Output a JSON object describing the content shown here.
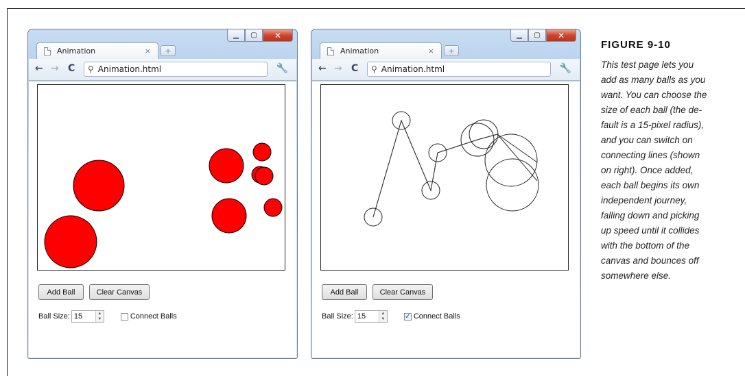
{
  "figure": {
    "title": "FIGURE 9-10",
    "caption_lines": [
      "This test page lets you",
      "add as many balls as you",
      "want. You can choose the",
      "size of each ball (the de-",
      "fault is a 15-pixel radius),",
      "and you can switch on",
      "connecting lines (shown",
      "on right). Once added,",
      "each ball begins its own",
      "independent journey,",
      "falling down and picking",
      "up speed until it collides",
      "with the bottom of the",
      "canvas and bounces off",
      "somewhere else."
    ]
  },
  "left_window": {
    "tab_title": "Animation",
    "tab_close": "×",
    "new_tab_icon": "+",
    "address": "Animation.html",
    "add_button": "Add Ball",
    "clear_button": "Clear Canvas",
    "ball_size_label": "Ball Size:",
    "ball_size_value": "15",
    "connect_label": "Connect Balls",
    "connect_checked": false,
    "ball_color": "#ff0000"
  },
  "right_window": {
    "tab_title": "Animation",
    "tab_close": "×",
    "new_tab_icon": "+",
    "address": "Animation.html",
    "add_button": "Add Ball",
    "clear_button": "Clear Canvas",
    "ball_size_label": "Ball Size:",
    "ball_size_value": "15",
    "connect_label": "Connect Balls",
    "connect_checked": true,
    "ball_color": "none"
  },
  "icons": {
    "back": "arrow-left-icon",
    "forward": "arrow-right-icon",
    "reload": "reload-icon",
    "search": "magnifier-icon",
    "settings": "wrench-icon",
    "page": "page-icon"
  }
}
